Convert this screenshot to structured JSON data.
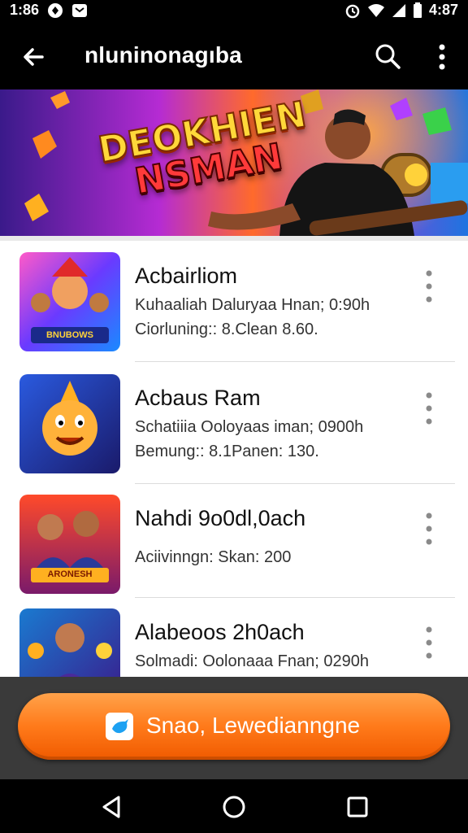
{
  "status_bar": {
    "time": "1:86",
    "right_time": "4:87"
  },
  "app_bar": {
    "title": "nluninonagıba",
    "back_icon": "arrow-back-icon",
    "search_icon": "search-icon",
    "menu_icon": "more-vert-icon"
  },
  "banner": {
    "headline_line1": "DEOKHIEN",
    "headline_line2": "NSMAN"
  },
  "items": [
    {
      "name": "Acbairliom",
      "meta1": "Kuhaaliah Daluryaa Hnan; 0:90h",
      "meta2": "Ciorluning:: 8.Clean 8.60.",
      "thumb_caption": "BNUBOWS"
    },
    {
      "name": "Acbaus Ram",
      "meta1": "Schatiiia Ooloyaas iman; 0900h",
      "meta2": "Bemung:: 8.1Panen: 130.",
      "thumb_caption": ""
    },
    {
      "name": "Nahdi 9o0dl,0ach",
      "meta1": "Aciivinngn: Skan: 200",
      "meta2": "",
      "thumb_caption": "ARONESH"
    },
    {
      "name": "Alabeoos 2h0ach",
      "meta1": "Solmadi: Oolonaaa Fnan; 0290h",
      "meta2": "",
      "thumb_caption": ""
    }
  ],
  "cta": {
    "label": "Snao, Lewedianngne",
    "icon": "bird-icon"
  },
  "colors": {
    "cta_orange": "#ff7a1a",
    "app_bar_bg": "#000000",
    "list_bg": "#ffffff"
  }
}
